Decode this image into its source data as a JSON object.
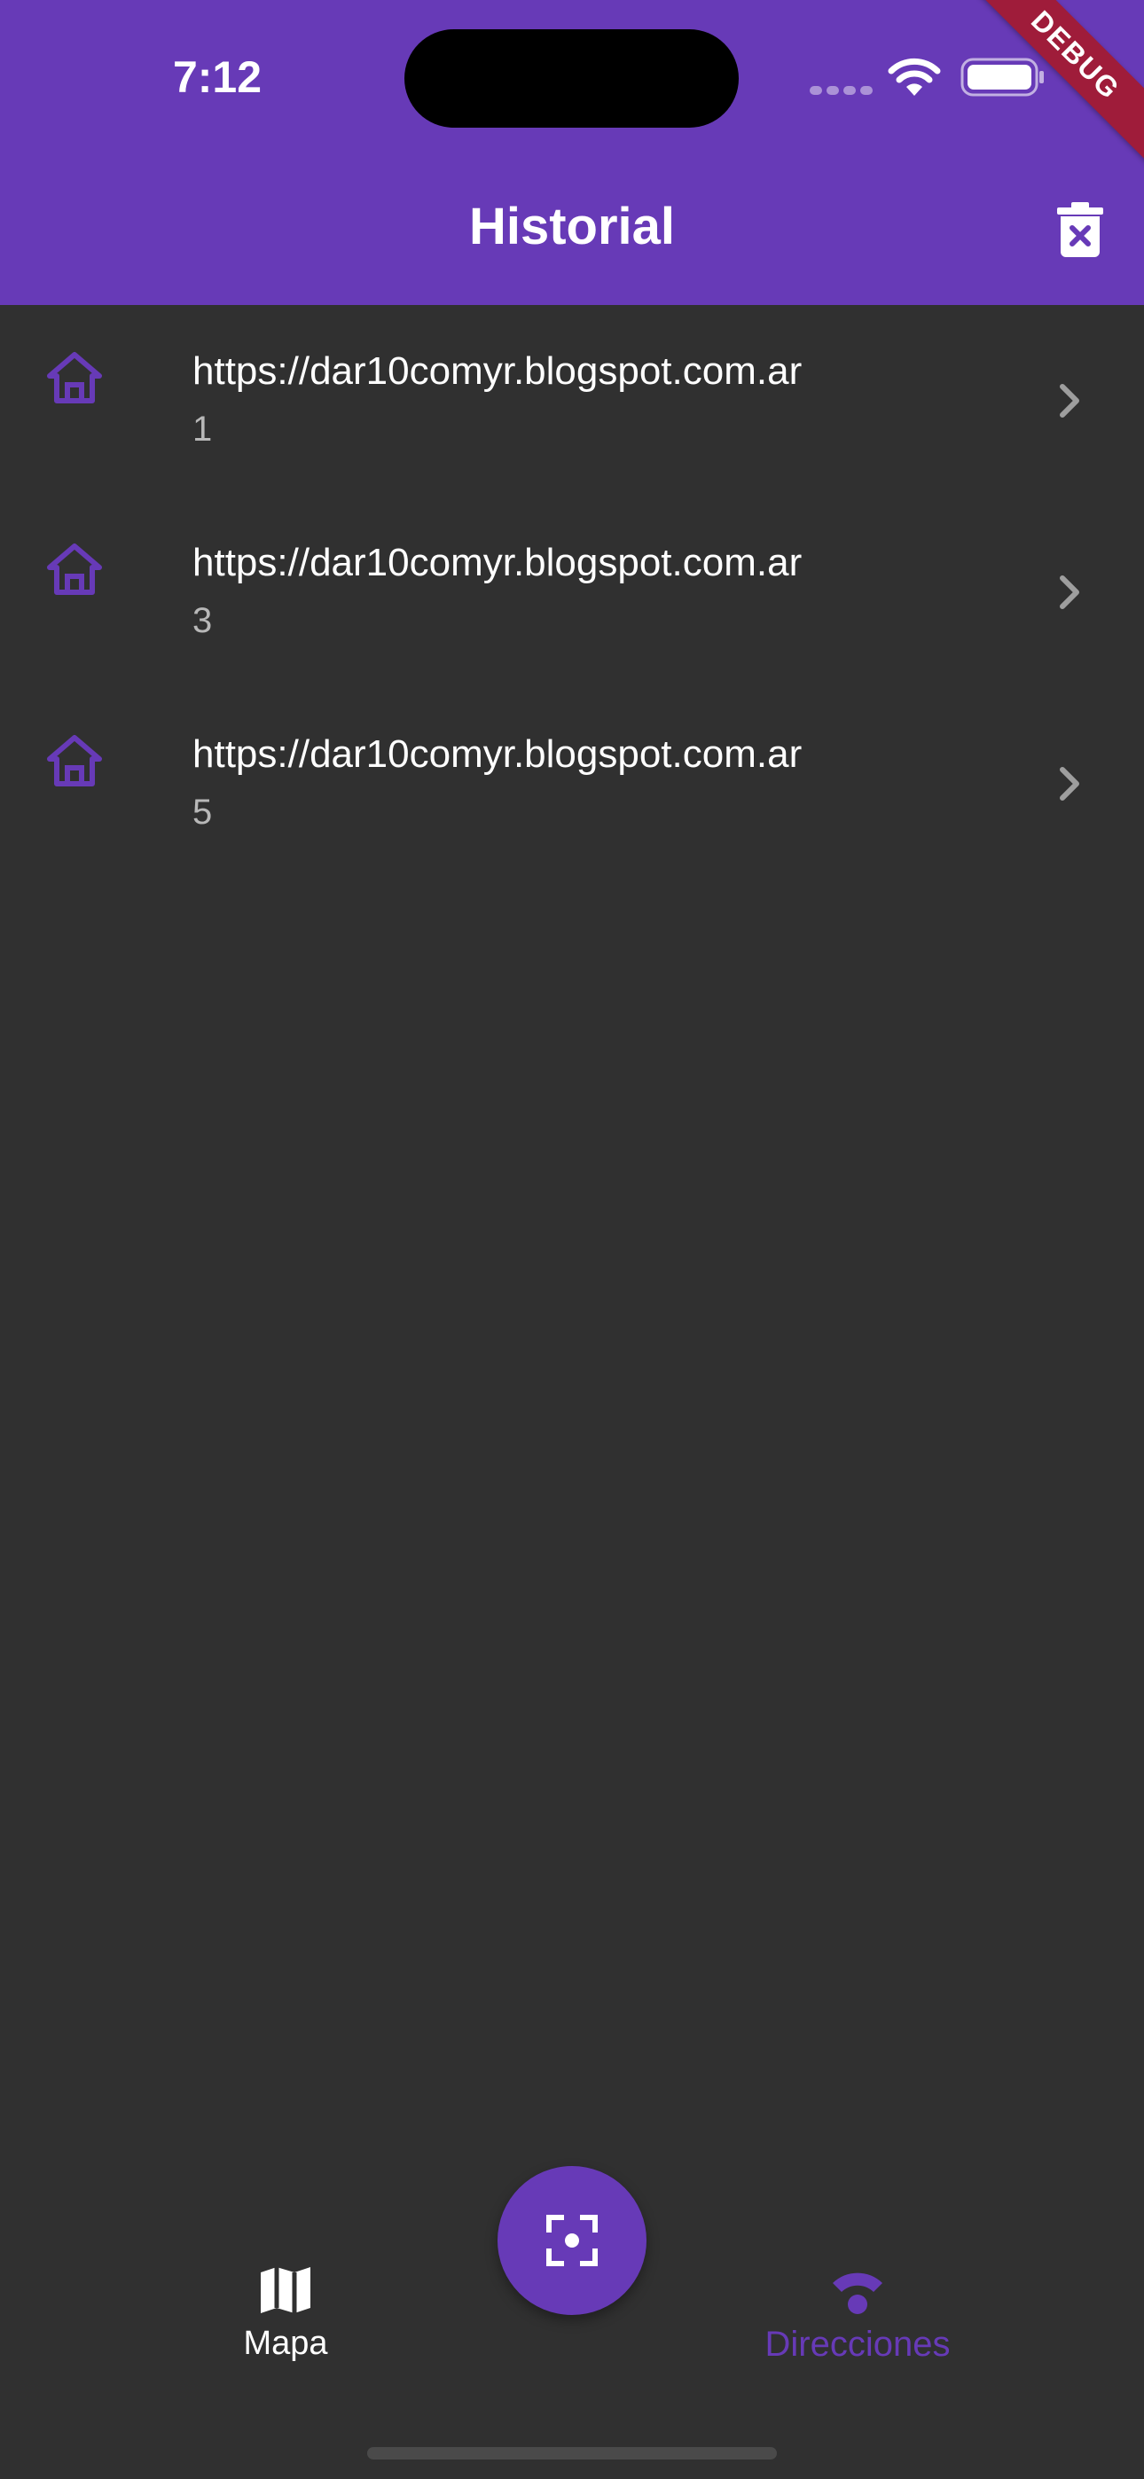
{
  "status_bar": {
    "time": "7:12"
  },
  "debug_banner": "DEBUG",
  "app_bar": {
    "title": "Historial",
    "delete_icon": "trash-x-icon"
  },
  "scans": [
    {
      "url": "https://dar10comyr.blogspot.com.ar",
      "id": "1",
      "icon": "home-icon"
    },
    {
      "url": "https://dar10comyr.blogspot.com.ar",
      "id": "3",
      "icon": "home-icon"
    },
    {
      "url": "https://dar10comyr.blogspot.com.ar",
      "id": "5",
      "icon": "home-icon"
    }
  ],
  "fab": {
    "icon": "scan-focus-icon"
  },
  "bottom_nav": {
    "items": [
      {
        "label": "Mapa",
        "icon": "map-icon",
        "selected": false
      },
      {
        "label": "Direcciones",
        "icon": "wifi-icon",
        "selected": true
      }
    ]
  },
  "colors": {
    "primary": "#673ab7",
    "background": "#303030",
    "debug": "#9f1c3a"
  }
}
